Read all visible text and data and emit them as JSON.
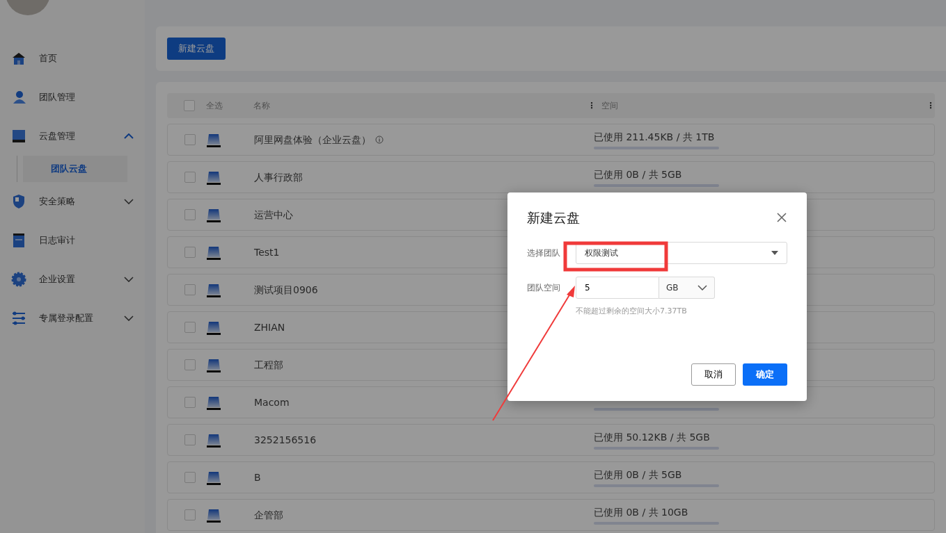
{
  "sidebar": {
    "items": [
      {
        "label": "首页",
        "selected": false
      },
      {
        "label": "团队管理",
        "selected": false
      },
      {
        "label": "云盘管理",
        "selected": false,
        "expanded": true,
        "children": [
          {
            "label": "团队云盘",
            "selected": true
          }
        ]
      },
      {
        "label": "安全策略",
        "selected": false,
        "expanded": false
      },
      {
        "label": "日志审计",
        "selected": false
      },
      {
        "label": "企业设置",
        "selected": false,
        "expanded": false
      },
      {
        "label": "专属登录配置",
        "selected": false,
        "expanded": false
      }
    ]
  },
  "toolbar": {
    "new_button": "新建云盘"
  },
  "table": {
    "select_all": {
      "label": "全选",
      "checked": false
    },
    "columns": [
      "名称",
      "空间"
    ],
    "column_handles": [
      "⋮",
      "⋮"
    ],
    "rows": [
      {
        "name": "阿里网盘体验（企业云盘）",
        "info": true,
        "space": "已使用 211.45KB / 共 1TB",
        "checked": false
      },
      {
        "name": "人事行政部",
        "space": "已使用 0B / 共 5GB",
        "checked": false
      },
      {
        "name": "运营中心",
        "checked": false
      },
      {
        "name": "Test1",
        "checked": false
      },
      {
        "name": "测试项目0906",
        "checked": false
      },
      {
        "name": "ZHIAN",
        "checked": false
      },
      {
        "name": "工程部",
        "checked": false
      },
      {
        "name": "Macom",
        "bar": true,
        "checked": false
      },
      {
        "name": "3252156516",
        "space": "已使用 50.12KB / 共 5GB",
        "checked": false
      },
      {
        "name": "B",
        "space": "已使用 0B / 共 5GB",
        "checked": false
      },
      {
        "name": "企管部",
        "space": "已使用 0B / 共 10GB",
        "checked": false
      }
    ]
  },
  "dialog": {
    "title": "新建云盘",
    "team_label": "选择团队",
    "team_value": "权限测试",
    "space_label": "团队空间",
    "space_value": "5",
    "unit": "GB",
    "hint": "不能超过剩余的空间大小7.37TB",
    "cancel": "取消",
    "ok": "确定"
  }
}
